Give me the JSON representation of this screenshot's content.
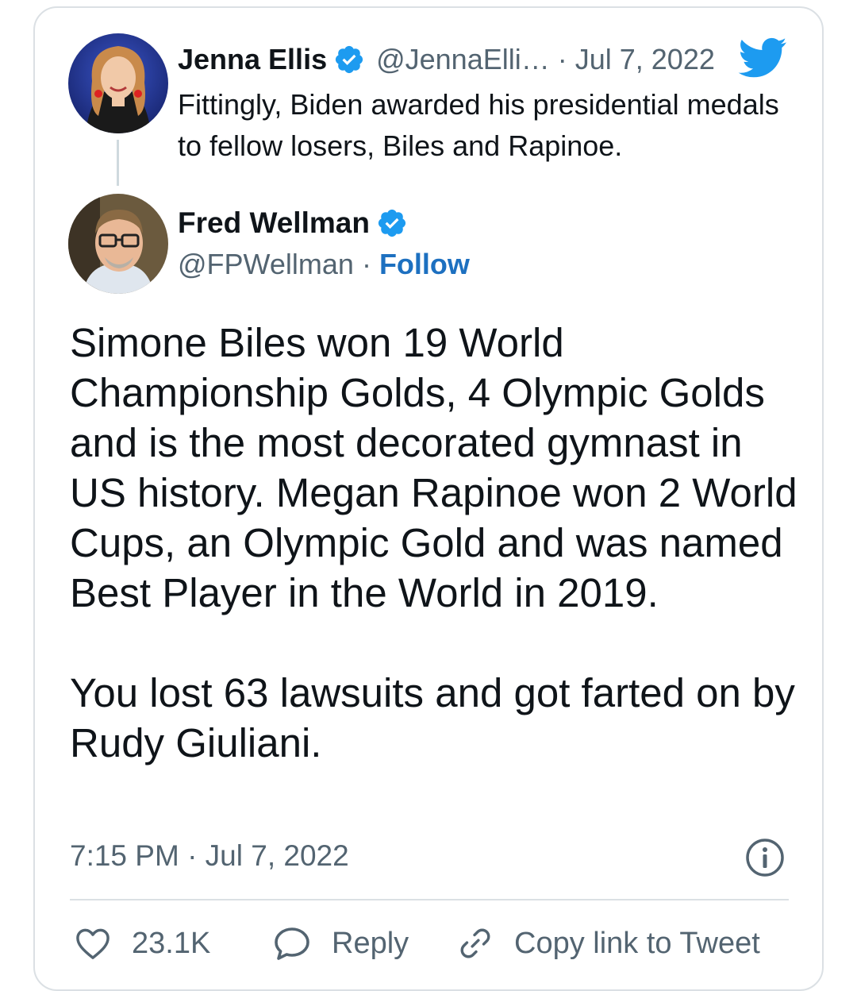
{
  "quoted_tweet": {
    "author_name": "Jenna Ellis",
    "handle": "@JennaElli…",
    "separator": "·",
    "date": "Jul 7, 2022",
    "text": "Fittingly, Biden awarded his presidential medals to fellow losers, Biles and Rapinoe."
  },
  "main_tweet": {
    "author_name": "Fred Wellman",
    "handle": "@FPWellman",
    "separator": "·",
    "follow_label": "Follow",
    "paragraph_1": "Simone Biles won 19 World Championship Golds, 4 Olympic Golds and is the most decorated gymnast in US history. Megan Rapinoe won 2 World Cups, an Olympic Gold and was named Best Player in the World in 2019.",
    "paragraph_2": "You lost 63 lawsuits and got farted on by Rudy Giuliani.",
    "timestamp": "7:15 PM · Jul 7, 2022"
  },
  "actions": {
    "like_count": "23.1K",
    "reply_label": "Reply",
    "copy_link_label": "Copy link to Tweet"
  },
  "icons": {
    "verified": "verified-badge-icon",
    "twitter": "twitter-bird-icon",
    "info": "info-icon",
    "like": "heart-icon",
    "reply": "speech-bubble-icon",
    "copy_link": "link-icon"
  },
  "colors": {
    "accent": "#1d9bf0",
    "follow": "#1d70c0",
    "muted": "#536471",
    "text": "#0f1419",
    "border": "#dbe0e4"
  }
}
